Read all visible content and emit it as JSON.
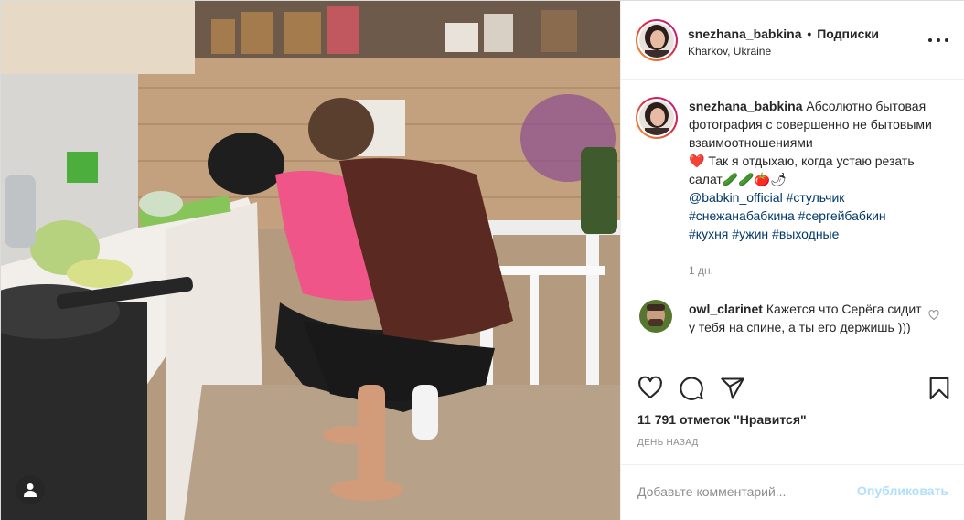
{
  "post": {
    "username": "snezhana_babkina",
    "separator": "•",
    "follow_label": "Подписки",
    "location": "Kharkov, Ukraine"
  },
  "caption": {
    "username": "snezhana_babkina",
    "text_part1": "Абсолютно бытовая фотография с совершенно не бытовыми взаимоотношениями",
    "heart_emoji": "❤️",
    "text_part2": " Так я отдыхаю, когда устаю резать салат",
    "food_emoji": "🥒🥒🍅🌶",
    "mention": "@babkin_official",
    "hashtags": [
      "#стульчик",
      "#снежанабабкина",
      "#сергейбабкин",
      "#кухня",
      "#ужин",
      "#выходные"
    ],
    "time": "1 дн."
  },
  "reply": {
    "username": "owl_clarinet",
    "text": "Кажется что Серёга сидит у тебя на спине, а ты его держишь )))"
  },
  "actions": {
    "likes": "11 791 отметок \"Нравится\"",
    "date": "ДЕНЬ НАЗАД"
  },
  "comment_form": {
    "placeholder": "Добавьте комментарий...",
    "publish_label": "Опубликовать"
  },
  "icons": {
    "more": "more-icon",
    "like": "heart-icon",
    "comment": "comment-icon",
    "share": "share-icon",
    "save": "bookmark-icon",
    "user_tag": "user-icon",
    "comment_like": "small-heart-icon"
  },
  "colors": {
    "text": "#262626",
    "secondary": "#8e8e8e",
    "link": "#00376b",
    "publish_disabled": "#b2dffc",
    "border": "#efefef"
  }
}
